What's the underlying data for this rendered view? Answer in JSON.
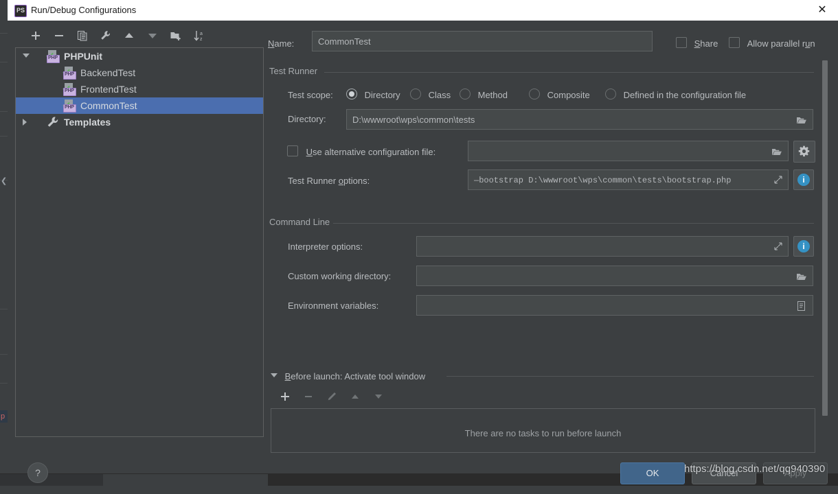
{
  "window": {
    "title": "Run/Debug Configurations",
    "app_icon": "phpstorm-icon",
    "close_label": "✕"
  },
  "toolbar": {
    "items": [
      {
        "name": "add-configuration-button",
        "icon": "plus-icon",
        "label": "+"
      },
      {
        "name": "remove-configuration-button",
        "icon": "minus-icon",
        "label": "−"
      },
      {
        "name": "copy-configuration-button",
        "icon": "copy-icon",
        "label": "Copy"
      },
      {
        "name": "edit-templates-button",
        "icon": "wrench-icon",
        "label": "Edit Templates"
      },
      {
        "name": "move-up-button",
        "icon": "arrow-up-icon",
        "label": "Move Up"
      },
      {
        "name": "move-down-button",
        "icon": "arrow-down-icon",
        "label": "Move Down"
      },
      {
        "name": "new-folder-button",
        "icon": "new-folder-icon",
        "label": "New Folder"
      },
      {
        "name": "sort-configurations-button",
        "icon": "sort-az-icon",
        "label": "Sort"
      }
    ]
  },
  "tree": {
    "nodes": [
      {
        "label": "PHPUnit",
        "icon": "php-test-icon",
        "arrow": "down",
        "level": 0,
        "selected": false,
        "bold": true
      },
      {
        "label": "BackendTest",
        "icon": "php-test-icon",
        "arrow": "none",
        "level": 1,
        "selected": false,
        "bold": false
      },
      {
        "label": "FrontendTest",
        "icon": "php-test-icon",
        "arrow": "none",
        "level": 1,
        "selected": false,
        "bold": false
      },
      {
        "label": "CommonTest",
        "icon": "php-test-icon",
        "arrow": "none",
        "level": 1,
        "selected": true,
        "bold": false
      },
      {
        "label": "Templates",
        "icon": "wrench-icon",
        "arrow": "right",
        "level": 0,
        "selected": false,
        "bold": true
      }
    ]
  },
  "form": {
    "name_label": "Name:",
    "name_value": "CommonTest",
    "share_label": "Share",
    "share_checked": false,
    "allow_parallel_label": "Allow parallel run",
    "allow_parallel_checked": false,
    "test_runner_group": "Test Runner",
    "test_scope_label": "Test scope:",
    "test_scope_options": [
      {
        "label": "Directory",
        "selected": true
      },
      {
        "label": "Class",
        "selected": false
      },
      {
        "label": "Method",
        "selected": false
      },
      {
        "label": "Composite",
        "selected": false
      },
      {
        "label": "Defined in the configuration file",
        "selected": false
      }
    ],
    "directory_label": "Directory:",
    "directory_value": "D:\\wwwroot\\wps\\common\\tests",
    "alt_config_label": "Use alternative configuration file:",
    "alt_config_checked": false,
    "alt_config_value": "",
    "alt_config_gear_icon": "gear-icon",
    "test_runner_options_label": "Test Runner options:",
    "test_runner_options_value": "—bootstrap D:\\wwwroot\\wps\\common\\tests\\bootstrap.php",
    "command_line_group": "Command Line",
    "interpreter_options_label": "Interpreter options:",
    "interpreter_options_value": "",
    "custom_working_dir_label": "Custom working directory:",
    "custom_working_dir_value": "",
    "env_vars_label": "Environment variables:",
    "env_vars_value": "",
    "before_launch_label": "Before launch: Activate tool window",
    "before_launch_toolbar": [
      {
        "name": "add-task-button",
        "icon": "plus-icon"
      },
      {
        "name": "remove-task-button",
        "icon": "minus-icon"
      },
      {
        "name": "edit-task-button",
        "icon": "pencil-icon"
      },
      {
        "name": "task-move-up-button",
        "icon": "arrow-up-icon"
      },
      {
        "name": "task-move-down-button",
        "icon": "arrow-down-icon"
      }
    ],
    "no_tasks_message": "There are no tasks to run before launch"
  },
  "footer": {
    "help_label": "?",
    "ok_label": "OK",
    "cancel_label": "Cancel",
    "apply_label": "Apply",
    "apply_disabled": true
  },
  "overlay": {
    "watermark": "https://blog.csdn.net/qq940390"
  },
  "colors": {
    "dialog_bg": "#3c3f41",
    "field_bg": "#45494a",
    "selection_blue": "#4b6eaf",
    "primary_button": "#41658a",
    "info_blue": "#3592c4",
    "title_bar": "#ffffff"
  }
}
